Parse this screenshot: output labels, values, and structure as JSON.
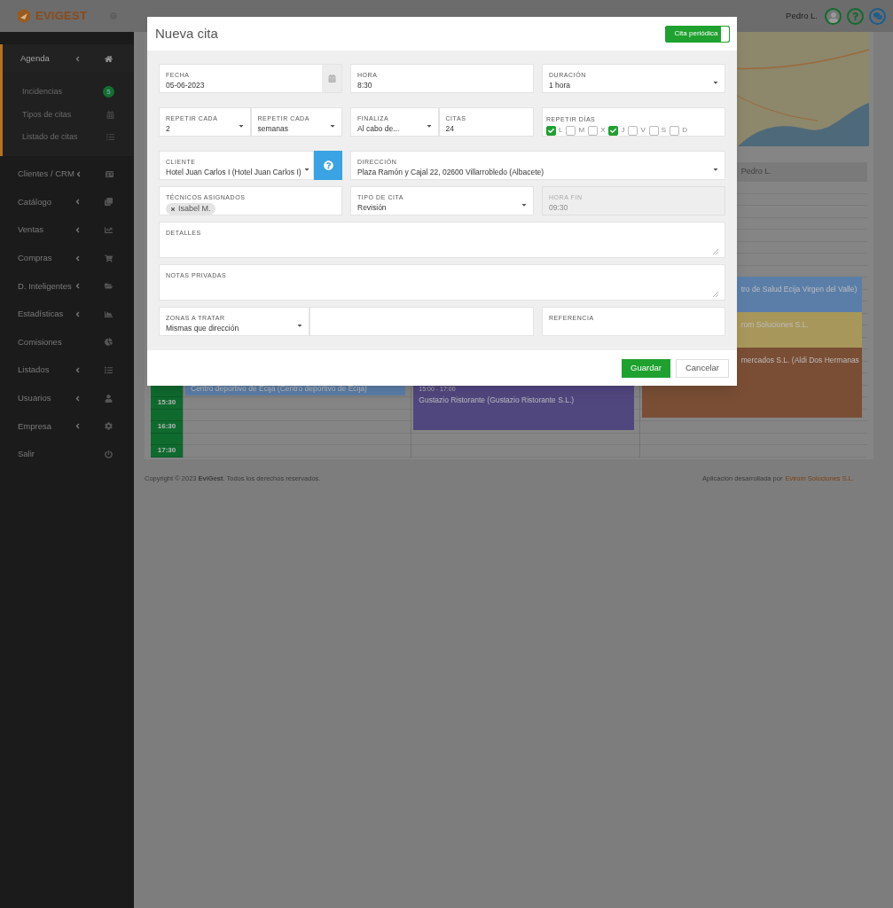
{
  "app": {
    "logo": "EVIGEST",
    "user": "Pedro L."
  },
  "sidebar": {
    "items": [
      {
        "label": "Agenda",
        "expandable": true,
        "expanded": true,
        "children": [
          {
            "label": "Incidencias",
            "badge": "5"
          },
          {
            "label": "Tipos de citas"
          },
          {
            "label": "Listado de citas"
          }
        ]
      },
      {
        "label": "Clientes / CRM",
        "expandable": true,
        "expanded": false
      },
      {
        "label": "Catálogo",
        "expandable": true,
        "expanded": false
      },
      {
        "label": "Ventas",
        "expandable": true,
        "expanded": false
      },
      {
        "label": "Compras",
        "expandable": true,
        "expanded": false
      },
      {
        "label": "D. Inteligentes",
        "expandable": true,
        "expanded": false
      },
      {
        "label": "Estadísticas",
        "expandable": true,
        "expanded": false
      },
      {
        "label": "Comisiones",
        "expandable": false,
        "expanded": false
      },
      {
        "label": "Listados",
        "expandable": true,
        "expanded": false
      },
      {
        "label": "Usuarios",
        "expandable": true,
        "expanded": false
      },
      {
        "label": "Empresa",
        "expandable": true,
        "expanded": false
      },
      {
        "label": "Salir",
        "expandable": false,
        "expanded": false
      }
    ]
  },
  "calendar": {
    "times": [
      "15:30",
      "16:30",
      "17:30"
    ],
    "columns": [
      {
        "events": [
          {
            "title": "Centro deportivo de Ecija (Centro deportivo de Ecija)",
            "color": "#5b7ea8"
          }
        ]
      },
      {
        "events": [
          {
            "time": "15:00 - 17:00",
            "title": "Gustazio Ristorante (Gustazio Ristorante S.L.)",
            "color": "#51477f"
          }
        ]
      },
      {
        "header": "Pedro L.",
        "events": [
          {
            "title": "tro de Salud Ecija Virgen del Valle)",
            "color": "#5b7ea8"
          },
          {
            "title": "rom Soluciones S.L.",
            "color": "#a8975a"
          },
          {
            "title": "mercados S.L. (Aldi Dos Hermanas",
            "color": "#7a4e35"
          }
        ]
      }
    ]
  },
  "footer": {
    "copyright": "Copyright © 2023 **EviGest**. Todos los derechos reservados.",
    "credit": "Aplicación desarrollada por",
    "credit_link": "Evirom Soluciones S.L."
  },
  "modal": {
    "title": "Nueva cita",
    "toggle": {
      "label": "Cita periódica",
      "on": true
    },
    "sections": [
      {
        "rows": [
          {
            "groups": [
              {
                "fields": [
                  {
                    "kind": "date",
                    "label": "FECHA",
                    "value": "05-06-2023"
                  }
                ]
              },
              {
                "fields": [
                  {
                    "kind": "text",
                    "label": "HORA",
                    "value": "8:30"
                  }
                ]
              },
              {
                "fields": [
                  {
                    "kind": "select",
                    "label": "DURACIÓN",
                    "value": "1 hora"
                  }
                ]
              }
            ]
          }
        ]
      },
      {
        "rows": [
          {
            "groups": [
              {
                "fields": [
                  {
                    "kind": "select",
                    "label": "REPETIR CADA",
                    "value": "2"
                  },
                  {
                    "kind": "select",
                    "label": "REPETIR CADA",
                    "value": "semanas"
                  }
                ]
              },
              {
                "fields": [
                  {
                    "kind": "select",
                    "label": "FINALIZA",
                    "value": "Al cabo de..."
                  },
                  {
                    "kind": "text",
                    "label": "CITAS",
                    "value": "24"
                  }
                ]
              },
              {
                "fields": [
                  {
                    "kind": "days",
                    "label": "REPETIR DÍAS",
                    "days": [
                      {
                        "label": "L",
                        "checked": true
                      },
                      {
                        "label": "M",
                        "checked": false
                      },
                      {
                        "label": "X",
                        "checked": false
                      },
                      {
                        "label": "J",
                        "checked": true
                      },
                      {
                        "label": "V",
                        "checked": false
                      },
                      {
                        "label": "S",
                        "checked": false
                      },
                      {
                        "label": "D",
                        "checked": false
                      }
                    ]
                  }
                ]
              }
            ]
          }
        ]
      },
      {
        "rows": [
          {
            "groups": [
              {
                "fields": [
                  {
                    "kind": "select",
                    "label": "CLIENTE",
                    "value": "Hotel Juan Carlos I (Hotel Juan Carlos I)"
                  },
                  {
                    "kind": "help"
                  }
                ]
              },
              {
                "fields": [
                  {
                    "kind": "select",
                    "label": "DIRECCIÓN",
                    "value": "Plaza Ramón y Cajal 22, 02600 Villarrobledo (Albacete)"
                  }
                ]
              }
            ]
          },
          {
            "groups": [
              {
                "fields": [
                  {
                    "kind": "tags",
                    "label": "TÉCNICOS ASIGNADOS",
                    "tags": [
                      "Isabel M."
                    ]
                  }
                ]
              },
              {
                "fields": [
                  {
                    "kind": "select",
                    "label": "TIPO DE CITA",
                    "value": "Revisión"
                  }
                ]
              },
              {
                "fields": [
                  {
                    "kind": "readonly",
                    "label": "HORA FIN",
                    "value": "09:30"
                  }
                ]
              }
            ]
          },
          {
            "groups": [
              {
                "fields": [
                  {
                    "kind": "textarea",
                    "label": "DETALLES"
                  }
                ]
              }
            ]
          },
          {
            "groups": [
              {
                "fields": [
                  {
                    "kind": "textarea",
                    "label": "NOTAS PRIVADAS"
                  }
                ]
              }
            ]
          },
          {
            "groups": [
              {
                "fields": [
                  {
                    "kind": "select",
                    "label": "ZONAS A TRATAR",
                    "value": "Mismas que dirección"
                  },
                  {
                    "kind": "text"
                  }
                ]
              },
              {
                "fields": [
                  {
                    "kind": "text",
                    "label": "REFERENCIA"
                  }
                ]
              }
            ]
          }
        ]
      }
    ],
    "buttons": [
      {
        "label": "Guardar",
        "kind": "primary"
      },
      {
        "label": "Cancelar",
        "kind": "default"
      }
    ]
  }
}
